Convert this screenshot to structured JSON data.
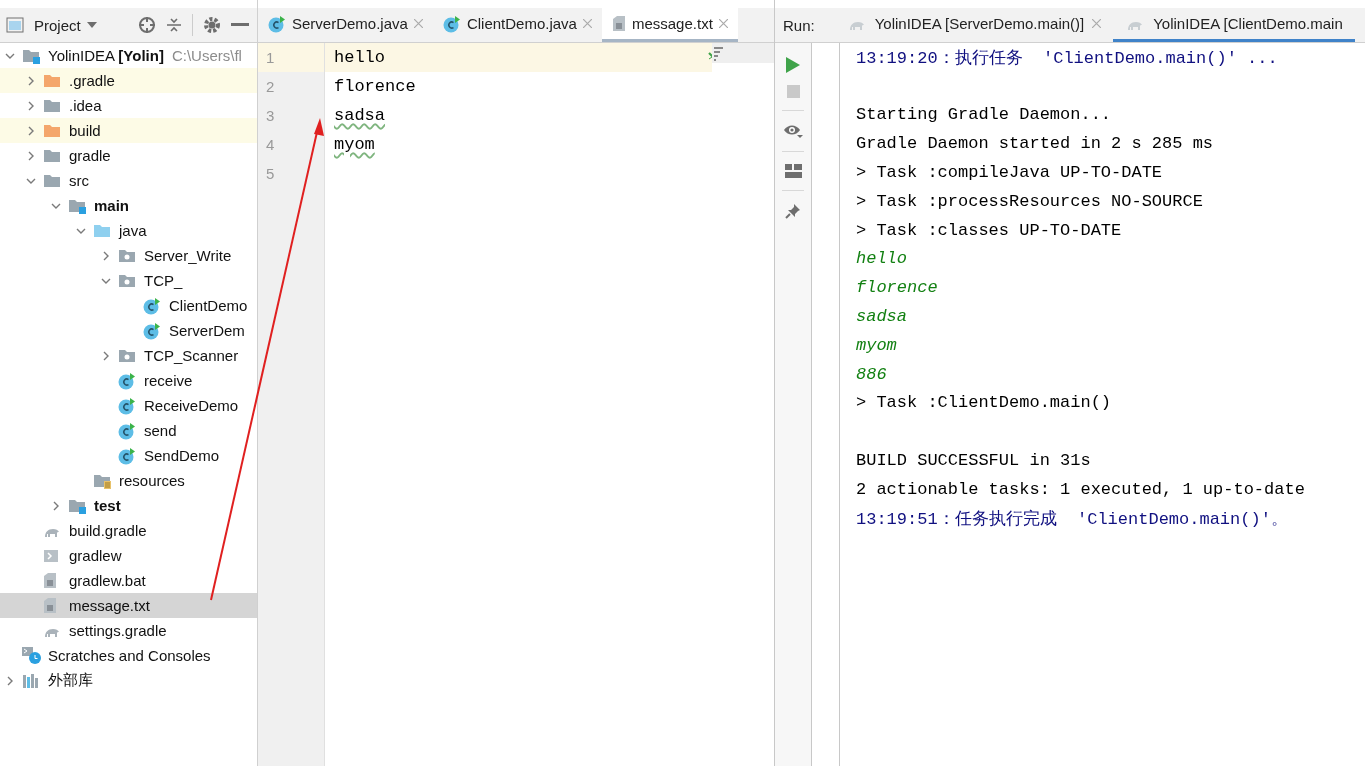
{
  "project_panel": {
    "title": "Project",
    "tree": [
      {
        "label": "YolinIDEA **[Yolin]**",
        "path": "C:\\Users\\fl",
        "kind": "module",
        "expanded": true,
        "selected": false,
        "children": [
          {
            "label": ".gradle",
            "kind": "excluded-folder",
            "expanded": false,
            "selected": false
          },
          {
            "label": ".idea",
            "kind": "folder",
            "expanded": false,
            "selected": false
          },
          {
            "label": "build",
            "kind": "excluded-folder",
            "expanded": false,
            "selected": false
          },
          {
            "label": "gradle",
            "kind": "folder",
            "expanded": false,
            "selected": false
          },
          {
            "label": "src",
            "kind": "folder",
            "expanded": true,
            "selected": false,
            "children": [
              {
                "label": "main",
                "kind": "source-set",
                "expanded": true,
                "selected": false,
                "children": [
                  {
                    "label": "java",
                    "kind": "source-folder",
                    "expanded": true,
                    "selected": false,
                    "children": [
                      {
                        "label": "Server_Write",
                        "kind": "package",
                        "expanded": false,
                        "selected": false
                      },
                      {
                        "label": "TCP_",
                        "kind": "package",
                        "expanded": true,
                        "selected": false,
                        "children": [
                          {
                            "label": "ClientDemo",
                            "kind": "class",
                            "selected": false
                          },
                          {
                            "label": "ServerDem",
                            "kind": "class",
                            "selected": false
                          }
                        ]
                      },
                      {
                        "label": "TCP_Scanner",
                        "kind": "package",
                        "expanded": false,
                        "selected": false
                      },
                      {
                        "label": "receive",
                        "kind": "class",
                        "selected": false
                      },
                      {
                        "label": "ReceiveDemo",
                        "kind": "class",
                        "selected": false
                      },
                      {
                        "label": "send",
                        "kind": "class",
                        "selected": false
                      },
                      {
                        "label": "SendDemo",
                        "kind": "class",
                        "selected": false
                      }
                    ]
                  },
                  {
                    "label": "resources",
                    "kind": "resources-folder",
                    "selected": false
                  }
                ]
              },
              {
                "label": "test",
                "kind": "source-set",
                "expanded": false,
                "selected": false
              }
            ]
          },
          {
            "label": "build.gradle",
            "kind": "gradle-file",
            "selected": false
          },
          {
            "label": "gradlew",
            "kind": "script-file",
            "selected": false
          },
          {
            "label": "gradlew.bat",
            "kind": "text-file",
            "selected": false
          },
          {
            "label": "message.txt",
            "kind": "text-file",
            "selected": true
          },
          {
            "label": "settings.gradle",
            "kind": "gradle-file",
            "selected": false
          }
        ]
      },
      {
        "label": "Scratches and Consoles",
        "kind": "scratches",
        "selected": false
      },
      {
        "label": "外部库",
        "kind": "library",
        "expanded": false,
        "selected": false
      }
    ]
  },
  "editor": {
    "tabs": [
      {
        "label": "ServerDemo.java",
        "kind": "class",
        "selected": false
      },
      {
        "label": "ClientDemo.java",
        "kind": "class",
        "selected": false
      },
      {
        "label": "message.txt",
        "kind": "text-file",
        "selected": true
      }
    ],
    "lines": [
      {
        "number": "1",
        "text": "hello",
        "current": true,
        "typo": false
      },
      {
        "number": "2",
        "text": "florence",
        "current": false,
        "typo": false
      },
      {
        "number": "3",
        "text": "sadsa",
        "current": false,
        "typo": true
      },
      {
        "number": "4",
        "text": "myom",
        "current": false,
        "typo": true
      },
      {
        "number": "5",
        "current": false
      }
    ]
  },
  "run_panel": {
    "label": "Run:",
    "tabs": [
      {
        "label": "YolinIDEA [ServerDemo.main()]",
        "selected": false,
        "closable": true
      },
      {
        "label": "YolinIDEA [ClientDemo.main",
        "selected": true,
        "closable": false
      }
    ],
    "console": [
      {
        "kind": "info",
        "text": "13:19:20：执行任务  'ClientDemo.main()' ..."
      },
      {
        "kind": "blank"
      },
      {
        "kind": "plain",
        "text": "Starting Gradle Daemon..."
      },
      {
        "kind": "plain",
        "text": "Gradle Daemon started in 2 s 285 ms"
      },
      {
        "kind": "plain",
        "text": "> Task :compileJava UP-TO-DATE"
      },
      {
        "kind": "plain",
        "text": "> Task :processResources NO-SOURCE"
      },
      {
        "kind": "plain",
        "text": "> Task :classes UP-TO-DATE"
      },
      {
        "kind": "output",
        "text": "hello"
      },
      {
        "kind": "output",
        "text": "florence"
      },
      {
        "kind": "output",
        "text": "sadsa"
      },
      {
        "kind": "output",
        "text": "myom"
      },
      {
        "kind": "output",
        "text": "886"
      },
      {
        "kind": "plain",
        "text": "> Task :ClientDemo.main()"
      },
      {
        "kind": "blank"
      },
      {
        "kind": "plain",
        "text": "BUILD SUCCESSFUL in 31s"
      },
      {
        "kind": "plain",
        "text": "2 actionable tasks: 1 executed, 1 up-to-date"
      },
      {
        "kind": "info",
        "text": "13:19:51：任务执行完成  'ClientDemo.main()'。"
      }
    ]
  }
}
